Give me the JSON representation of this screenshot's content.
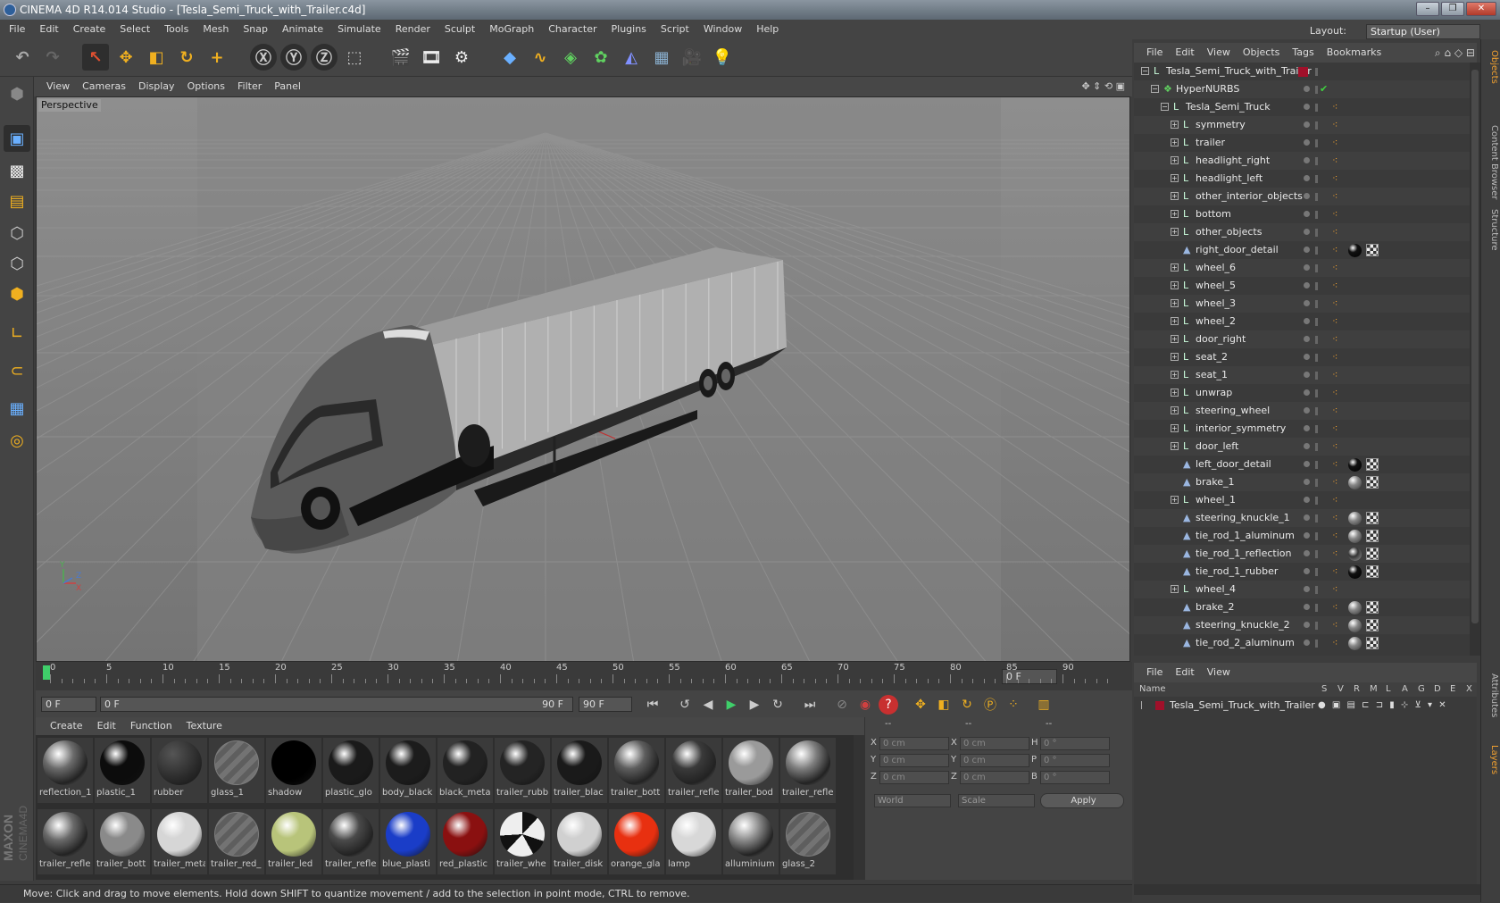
{
  "window": {
    "title": "CINEMA 4D R14.014 Studio - [Tesla_Semi_Truck_with_Trailer.c4d]"
  },
  "menubar": {
    "items": [
      "File",
      "Edit",
      "Create",
      "Select",
      "Tools",
      "Mesh",
      "Snap",
      "Animate",
      "Simulate",
      "Render",
      "Sculpt",
      "MoGraph",
      "Character",
      "Plugins",
      "Script",
      "Window",
      "Help"
    ],
    "layout_label": "Layout:",
    "layout_value": "Startup (User)"
  },
  "viewport": {
    "menu": [
      "View",
      "Cameras",
      "Display",
      "Options",
      "Filter",
      "Panel"
    ],
    "label": "Perspective",
    "axis": {
      "y": "Y",
      "z": "Z",
      "x": "X"
    }
  },
  "timeline": {
    "ticks": [
      "0",
      "5",
      "10",
      "15",
      "20",
      "25",
      "30",
      "35",
      "40",
      "45",
      "50",
      "55",
      "60",
      "65",
      "70",
      "75",
      "80",
      "85",
      "90"
    ],
    "current_frame": "0 F"
  },
  "controls": {
    "start_field": "0 F",
    "range_start": "0 F",
    "range_end": "90 F",
    "end_field": "90 F"
  },
  "materials": {
    "menu": [
      "Create",
      "Edit",
      "Function",
      "Texture"
    ],
    "items": [
      {
        "name": "reflection_1",
        "color": "#6b6b6b",
        "kind": "chrome"
      },
      {
        "name": "plastic_1",
        "color": "#0c0c0c",
        "kind": "gloss"
      },
      {
        "name": "rubber",
        "color": "#2a2a2a",
        "kind": "matte"
      },
      {
        "name": "glass_1",
        "color": "#8a8a8a",
        "kind": "glass"
      },
      {
        "name": "shadow",
        "color": "#000000",
        "kind": "matte"
      },
      {
        "name": "plastic_glo",
        "color": "#1a1a1a",
        "kind": "gloss"
      },
      {
        "name": "body_black",
        "color": "#1c1c1c",
        "kind": "gloss"
      },
      {
        "name": "black_meta",
        "color": "#222222",
        "kind": "gloss"
      },
      {
        "name": "trailer_rubb",
        "color": "#242424",
        "kind": "gloss"
      },
      {
        "name": "trailer_blac",
        "color": "#1a1a1a",
        "kind": "gloss"
      },
      {
        "name": "trailer_bott",
        "color": "#5e5e5e",
        "kind": "chrome"
      },
      {
        "name": "trailer_refle",
        "color": "#3a3a3a",
        "kind": "chrome"
      },
      {
        "name": "trailer_bod",
        "color": "#9a9a9a",
        "kind": "gloss"
      },
      {
        "name": "trailer_refle",
        "color": "#7e7e7e",
        "kind": "chrome"
      },
      {
        "name": "trailer_refle",
        "color": "#6a6a6a",
        "kind": "chrome"
      },
      {
        "name": "trailer_bott",
        "color": "#8a8a8a",
        "kind": "gloss"
      },
      {
        "name": "trailer_meta",
        "color": "#d6d6d6",
        "kind": "gloss"
      },
      {
        "name": "trailer_red_",
        "color": "#b01010",
        "kind": "glass"
      },
      {
        "name": "trailer_led",
        "color": "#b8c47a",
        "kind": "gloss"
      },
      {
        "name": "trailer_refle",
        "color": "#4a4a4a",
        "kind": "chrome"
      },
      {
        "name": "blue_plasti",
        "color": "#1a3dc8",
        "kind": "gloss"
      },
      {
        "name": "red_plastic",
        "color": "#8a1010",
        "kind": "gloss"
      },
      {
        "name": "trailer_whe",
        "color": "#e0e0e0",
        "kind": "stripe"
      },
      {
        "name": "trailer_disk",
        "color": "#d0d0d0",
        "kind": "gloss"
      },
      {
        "name": "orange_gla",
        "color": "#e83010",
        "kind": "gloss"
      },
      {
        "name": "lamp",
        "color": "#d8d8d8",
        "kind": "gloss"
      },
      {
        "name": "alluminium",
        "color": "#8c8c8c",
        "kind": "chrome"
      },
      {
        "name": "glass_2",
        "color": "#8a8a8a",
        "kind": "glass"
      }
    ]
  },
  "coords": {
    "header": [
      "--",
      "--",
      "--"
    ],
    "rows": [
      {
        "a": "X",
        "av": "0 cm",
        "b": "X",
        "bv": "0 cm",
        "c": "H",
        "cv": "0 °"
      },
      {
        "a": "Y",
        "av": "0 cm",
        "b": "Y",
        "bv": "0 cm",
        "c": "P",
        "cv": "0 °"
      },
      {
        "a": "Z",
        "av": "0 cm",
        "b": "Z",
        "bv": "0 cm",
        "c": "B",
        "cv": "0 °"
      }
    ],
    "mode": "World",
    "scale": "Scale",
    "apply": "Apply"
  },
  "status": "Move: Click and drag to move elements. Hold down SHIFT to quantize movement / add to the selection in point mode, CTRL to remove.",
  "objects": {
    "menu": [
      "File",
      "Edit",
      "View",
      "Objects",
      "Tags",
      "Bookmarks"
    ],
    "rows": [
      {
        "name": "Tesla_Semi_Truck_with_Trailer",
        "depth": 0,
        "icon": "null",
        "exp": "−",
        "tags": []
      },
      {
        "name": "HyperNURBS",
        "depth": 1,
        "icon": "hn",
        "exp": "−",
        "tags": [
          "check"
        ]
      },
      {
        "name": "Tesla_Semi_Truck",
        "depth": 2,
        "icon": "null",
        "exp": "−",
        "tags": [
          "phong"
        ]
      },
      {
        "name": "symmetry",
        "depth": 3,
        "icon": "null",
        "exp": "+",
        "tags": [
          "phong"
        ]
      },
      {
        "name": "trailer",
        "depth": 3,
        "icon": "null",
        "exp": "+",
        "tags": [
          "phong"
        ]
      },
      {
        "name": "headlight_right",
        "depth": 3,
        "icon": "null",
        "exp": "+",
        "tags": [
          "phong"
        ]
      },
      {
        "name": "headlight_left",
        "depth": 3,
        "icon": "null",
        "exp": "+",
        "tags": [
          "phong"
        ]
      },
      {
        "name": "other_interior_objects",
        "depth": 3,
        "icon": "null",
        "exp": "+",
        "tags": [
          "phong"
        ]
      },
      {
        "name": "bottom",
        "depth": 3,
        "icon": "null",
        "exp": "+",
        "tags": [
          "phong"
        ]
      },
      {
        "name": "other_objects",
        "depth": 3,
        "icon": "null",
        "exp": "+",
        "tags": [
          "phong"
        ]
      },
      {
        "name": "right_door_detail",
        "depth": 3,
        "icon": "poly",
        "exp": "",
        "tags": [
          "phong",
          "black",
          "check"
        ]
      },
      {
        "name": "wheel_6",
        "depth": 3,
        "icon": "null",
        "exp": "+",
        "tags": [
          "phong"
        ]
      },
      {
        "name": "wheel_5",
        "depth": 3,
        "icon": "null",
        "exp": "+",
        "tags": [
          "phong"
        ]
      },
      {
        "name": "wheel_3",
        "depth": 3,
        "icon": "null",
        "exp": "+",
        "tags": [
          "phong"
        ]
      },
      {
        "name": "wheel_2",
        "depth": 3,
        "icon": "null",
        "exp": "+",
        "tags": [
          "phong"
        ]
      },
      {
        "name": "door_right",
        "depth": 3,
        "icon": "null",
        "exp": "+",
        "tags": [
          "phong"
        ]
      },
      {
        "name": "seat_2",
        "depth": 3,
        "icon": "null",
        "exp": "+",
        "tags": [
          "phong"
        ]
      },
      {
        "name": "seat_1",
        "depth": 3,
        "icon": "null",
        "exp": "+",
        "tags": [
          "phong"
        ]
      },
      {
        "name": "unwrap",
        "depth": 3,
        "icon": "null",
        "exp": "+",
        "tags": [
          "phong"
        ]
      },
      {
        "name": "steering_wheel",
        "depth": 3,
        "icon": "null",
        "exp": "+",
        "tags": [
          "phong"
        ]
      },
      {
        "name": "interior_symmetry",
        "depth": 3,
        "icon": "null",
        "exp": "+",
        "tags": [
          "phong"
        ]
      },
      {
        "name": "door_left",
        "depth": 3,
        "icon": "null",
        "exp": "+",
        "tags": [
          "phong"
        ]
      },
      {
        "name": "left_door_detail",
        "depth": 3,
        "icon": "poly",
        "exp": "",
        "tags": [
          "phong",
          "black",
          "check"
        ]
      },
      {
        "name": "brake_1",
        "depth": 3,
        "icon": "poly",
        "exp": "",
        "tags": [
          "phong",
          "grey",
          "check"
        ]
      },
      {
        "name": "wheel_1",
        "depth": 3,
        "icon": "null",
        "exp": "+",
        "tags": [
          "phong"
        ]
      },
      {
        "name": "steering_knuckle_1",
        "depth": 3,
        "icon": "poly",
        "exp": "",
        "tags": [
          "phong",
          "grey",
          "check"
        ]
      },
      {
        "name": "tie_rod_1_aluminum",
        "depth": 3,
        "icon": "poly",
        "exp": "",
        "tags": [
          "phong",
          "grey",
          "check"
        ]
      },
      {
        "name": "tie_rod_1_reflection",
        "depth": 3,
        "icon": "poly",
        "exp": "",
        "tags": [
          "phong",
          "chrome",
          "check"
        ]
      },
      {
        "name": "tie_rod_1_rubber",
        "depth": 3,
        "icon": "poly",
        "exp": "",
        "tags": [
          "phong",
          "black",
          "check"
        ]
      },
      {
        "name": "wheel_4",
        "depth": 3,
        "icon": "null",
        "exp": "+",
        "tags": [
          "phong"
        ]
      },
      {
        "name": "brake_2",
        "depth": 3,
        "icon": "poly",
        "exp": "",
        "tags": [
          "phong",
          "grey",
          "check"
        ]
      },
      {
        "name": "steering_knuckle_2",
        "depth": 3,
        "icon": "poly",
        "exp": "",
        "tags": [
          "phong",
          "grey",
          "check"
        ]
      },
      {
        "name": "tie_rod_2_aluminum",
        "depth": 3,
        "icon": "poly",
        "exp": "",
        "tags": [
          "phong",
          "grey",
          "check"
        ]
      }
    ]
  },
  "layers": {
    "menu": [
      "File",
      "Edit",
      "View"
    ],
    "columns": [
      "Name",
      "S",
      "V",
      "R",
      "M",
      "L",
      "A",
      "G",
      "D",
      "E",
      "X"
    ],
    "rows": [
      {
        "name": "Tesla_Semi_Truck_with_Trailer",
        "color": "#a0102a"
      }
    ]
  },
  "side_tabs": [
    "Objects",
    "Content Browser",
    "Structure",
    "Attributes",
    "Layers"
  ],
  "colors": {
    "accent": "#f0a030",
    "select": "#e07030"
  }
}
